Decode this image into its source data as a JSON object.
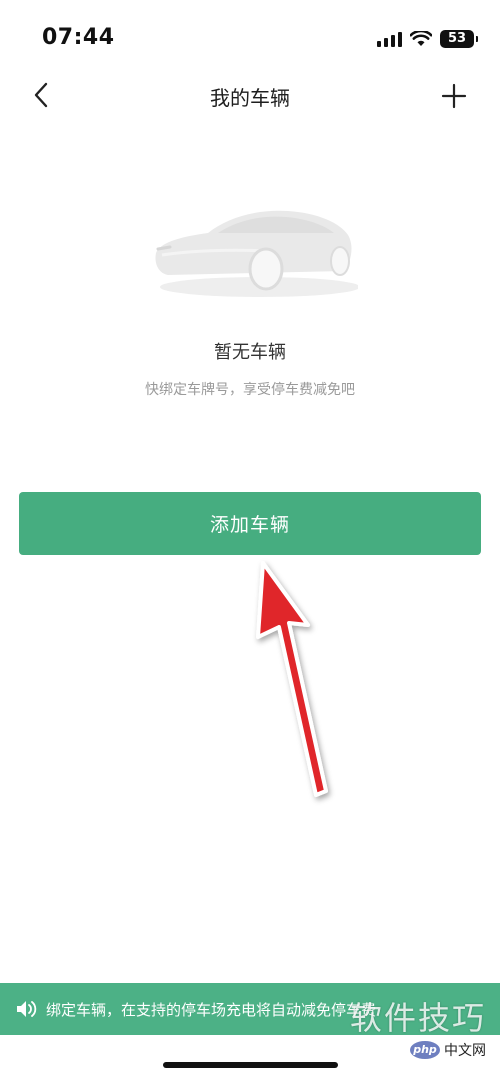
{
  "status_bar": {
    "time": "07:44",
    "battery": "53"
  },
  "nav": {
    "title": "我的车辆"
  },
  "empty_state": {
    "title": "暂无车辆",
    "subtitle": "快绑定车牌号，享受停车费减免吧"
  },
  "actions": {
    "add_vehicle_label": "添加车辆"
  },
  "notice": {
    "text": "绑定车辆，在支持的停车场充电将自动减免停车费"
  },
  "watermark": {
    "text": "软件技巧",
    "logo": "php",
    "site": "中文网"
  },
  "colors": {
    "primary_green": "#46ad80",
    "notice_green": "#4cb186",
    "annotation_red": "#e0262b"
  },
  "icons": {
    "back": "chevron-left-icon",
    "add": "plus-icon",
    "speaker": "speaker-icon",
    "illustration": "car-illustration"
  }
}
